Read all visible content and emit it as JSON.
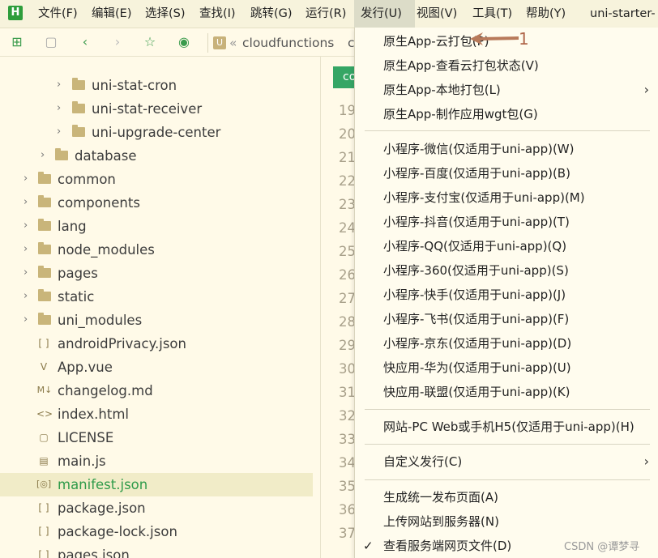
{
  "menubar": {
    "logo": "H",
    "items": [
      "文件(F)",
      "编辑(E)",
      "选择(S)",
      "查找(I)",
      "跳转(G)",
      "运行(R)",
      "发行(U)",
      "视图(V)",
      "工具(T)",
      "帮助(Y)"
    ],
    "window_title": "uni-starter-"
  },
  "toolbar": {
    "crumb_badge": "U",
    "crumb_sep": "«",
    "crumb_path": "cloudfunctions",
    "crumb_tail": "c"
  },
  "tree": [
    {
      "label": "uni-stat-cron",
      "type": "folder"
    },
    {
      "label": "uni-stat-receiver",
      "type": "folder"
    },
    {
      "label": "uni-upgrade-center",
      "type": "folder"
    },
    {
      "label": "database",
      "type": "folder"
    },
    {
      "label": "common",
      "type": "folder"
    },
    {
      "label": "components",
      "type": "folder"
    },
    {
      "label": "lang",
      "type": "folder"
    },
    {
      "label": "node_modules",
      "type": "folder"
    },
    {
      "label": "pages",
      "type": "folder"
    },
    {
      "label": "static",
      "type": "folder"
    },
    {
      "label": "uni_modules",
      "type": "folder"
    },
    {
      "label": "androidPrivacy.json",
      "type": "file",
      "icon": "[ ]"
    },
    {
      "label": "App.vue",
      "type": "file",
      "icon": "V"
    },
    {
      "label": "changelog.md",
      "type": "file",
      "icon": "M↓"
    },
    {
      "label": "index.html",
      "type": "file",
      "icon": "<>"
    },
    {
      "label": "LICENSE",
      "type": "file",
      "icon": "▢"
    },
    {
      "label": "main.js",
      "type": "file",
      "icon": "▤"
    },
    {
      "label": "manifest.json",
      "type": "file",
      "icon": "[◎]"
    },
    {
      "label": "package.json",
      "type": "file",
      "icon": "[ ]"
    },
    {
      "label": "package-lock.json",
      "type": "file",
      "icon": "[ ]"
    },
    {
      "label": "pages.json",
      "type": "file",
      "icon": "[ ]"
    }
  ],
  "editor": {
    "tab_label": "co",
    "line_numbers": [
      "19",
      "20",
      "21",
      "22",
      "23",
      "24",
      "25",
      "26",
      "27",
      "28",
      "29",
      "30",
      "31",
      "32",
      "33",
      "34",
      "35",
      "36",
      "37"
    ]
  },
  "dropdown": {
    "group1": [
      "原生App-云打包(P)",
      "原生App-查看云打包状态(V)",
      "原生App-本地打包(L)",
      "原生App-制作应用wgt包(G)"
    ],
    "group2": [
      "小程序-微信(仅适用于uni-app)(W)",
      "小程序-百度(仅适用于uni-app)(B)",
      "小程序-支付宝(仅适用于uni-app)(M)",
      "小程序-抖音(仅适用于uni-app)(T)",
      "小程序-QQ(仅适用于uni-app)(Q)",
      "小程序-360(仅适用于uni-app)(S)",
      "小程序-快手(仅适用于uni-app)(J)",
      "小程序-飞书(仅适用于uni-app)(F)",
      "小程序-京东(仅适用于uni-app)(D)",
      "快应用-华为(仅适用于uni-app)(U)",
      "快应用-联盟(仅适用于uni-app)(K)"
    ],
    "group3": [
      "网站-PC Web或手机H5(仅适用于uni-app)(H)"
    ],
    "group4": [
      "自定义发行(C)"
    ],
    "group5": [
      "生成统一发布页面(A)",
      "上传网站到服务器(N)",
      "查看服务端网页文件(D)"
    ]
  },
  "annotation": {
    "number": "1"
  },
  "watermark": "CSDN @谭梦寻"
}
